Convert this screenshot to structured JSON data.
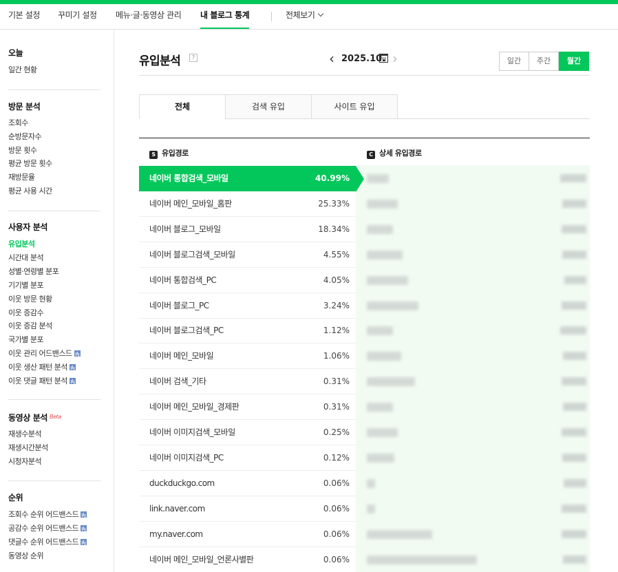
{
  "nav": {
    "items": [
      "기본 설정",
      "꾸미기 설정",
      "메뉴·글·동영상 관리",
      "내 블로그 통계"
    ],
    "view_all": "전체보기"
  },
  "sidebar": {
    "today_title": "오늘",
    "today_items": [
      "일간 현황"
    ],
    "visit_title": "방문 분석",
    "visit_items": [
      "조회수",
      "순방문자수",
      "방문 횟수",
      "평균 방문 횟수",
      "재방문율",
      "평균 사용 시간"
    ],
    "user_title": "사용자 분석",
    "user_items": [
      "유입분석",
      "시간대 분석",
      "성별·연령별 분포",
      "기기별 분포",
      "이웃 방문 현황",
      "이웃 증감수",
      "이웃 증감 분석",
      "국가별 분포",
      "이웃 관리 어드밴스드",
      "이웃 생산 패턴 분석",
      "이웃 댓글 패턴 분석"
    ],
    "video_title": "동영상 분석",
    "beta": "Beta",
    "video_items": [
      "재생수분석",
      "재생시간분석",
      "시청자분석"
    ],
    "rank_title": "순위",
    "rank_items": [
      "조회수 순위 어드밴스드",
      "공감수 순위 어드밴스드",
      "댓글수 순위 어드밴스드",
      "동영상 순위"
    ]
  },
  "main": {
    "title": "유입분석",
    "help": "?",
    "date": "2025.10.",
    "periods": [
      "일간",
      "주간",
      "월간"
    ],
    "active_period": "월간",
    "tabs": [
      "전체",
      "검색 유입",
      "사이트 유입"
    ],
    "active_tab": "전체",
    "col_left_icon": "S",
    "col_left": "유입경로",
    "col_right_icon": "C",
    "col_right": "상세 유입경로",
    "rows": [
      {
        "name": "네이버 통합검색_모바일",
        "pct": "40.99%"
      },
      {
        "name": "네이버 메인_모바일_홈판",
        "pct": "25.33%"
      },
      {
        "name": "네이버 블로그_모바일",
        "pct": "18.34%"
      },
      {
        "name": "네이버 블로그검색_모바일",
        "pct": "4.55%"
      },
      {
        "name": "네이버 통합검색_PC",
        "pct": "4.05%"
      },
      {
        "name": "네이버 블로그_PC",
        "pct": "3.24%"
      },
      {
        "name": "네이버 블로그검색_PC",
        "pct": "1.12%"
      },
      {
        "name": "네이버 메인_모바일",
        "pct": "1.06%"
      },
      {
        "name": "네이버 검색_기타",
        "pct": "0.31%"
      },
      {
        "name": "네이버 메인_모바일_경제판",
        "pct": "0.31%"
      },
      {
        "name": "네이버 이미지검색_모바일",
        "pct": "0.25%"
      },
      {
        "name": "네이버 이미지검색_PC",
        "pct": "0.12%"
      },
      {
        "name": "duckduckgo.com",
        "pct": "0.06%"
      },
      {
        "name": "link.naver.com",
        "pct": "0.06%"
      },
      {
        "name": "my.naver.com",
        "pct": "0.06%"
      },
      {
        "name": "네이버 메인_모바일_언론사별판",
        "pct": "0.06%"
      }
    ]
  },
  "colors": {
    "accent": "#03c75a",
    "panel": "#f2fbf2"
  },
  "icons": [
    "help-icon",
    "chevron-left-icon",
    "calendar-icon",
    "chevron-right-icon",
    "chevron-down-icon",
    "bar-chart-icon"
  ]
}
